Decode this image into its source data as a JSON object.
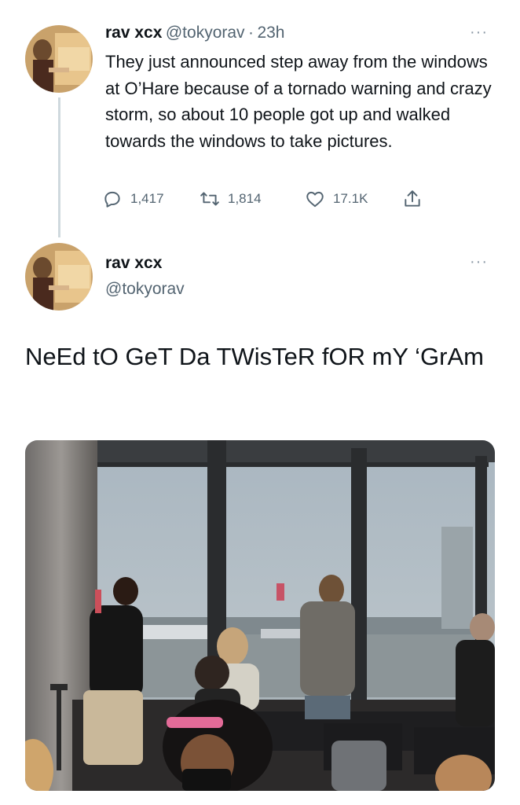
{
  "thread": {
    "tweet": {
      "author_name": "rav xcx",
      "author_handle": "@tokyorav",
      "separator": "·",
      "time": "23h",
      "text": "They just announced step away from the windows at O’Hare because of a tornado warning and crazy storm, so about 10 people got up and walked towards the windows to take pictures.",
      "more_label": "···",
      "actions": {
        "replies": "1,417",
        "retweets": "1,814",
        "likes": "17.1K"
      }
    },
    "reply": {
      "author_name": "rav xcx",
      "author_handle": "@tokyorav",
      "more_label": "···",
      "text": "NeEd tO GeT Da TWisTeR fOR mY ‘GrAm"
    }
  },
  "icons": {
    "reply": "speech-bubble-icon",
    "retweet": "retweet-arrows-icon",
    "like": "heart-icon",
    "share": "share-upload-icon"
  },
  "colors": {
    "text": "#0f1419",
    "secondary": "#536471",
    "thread_line": "#cfd9de"
  }
}
